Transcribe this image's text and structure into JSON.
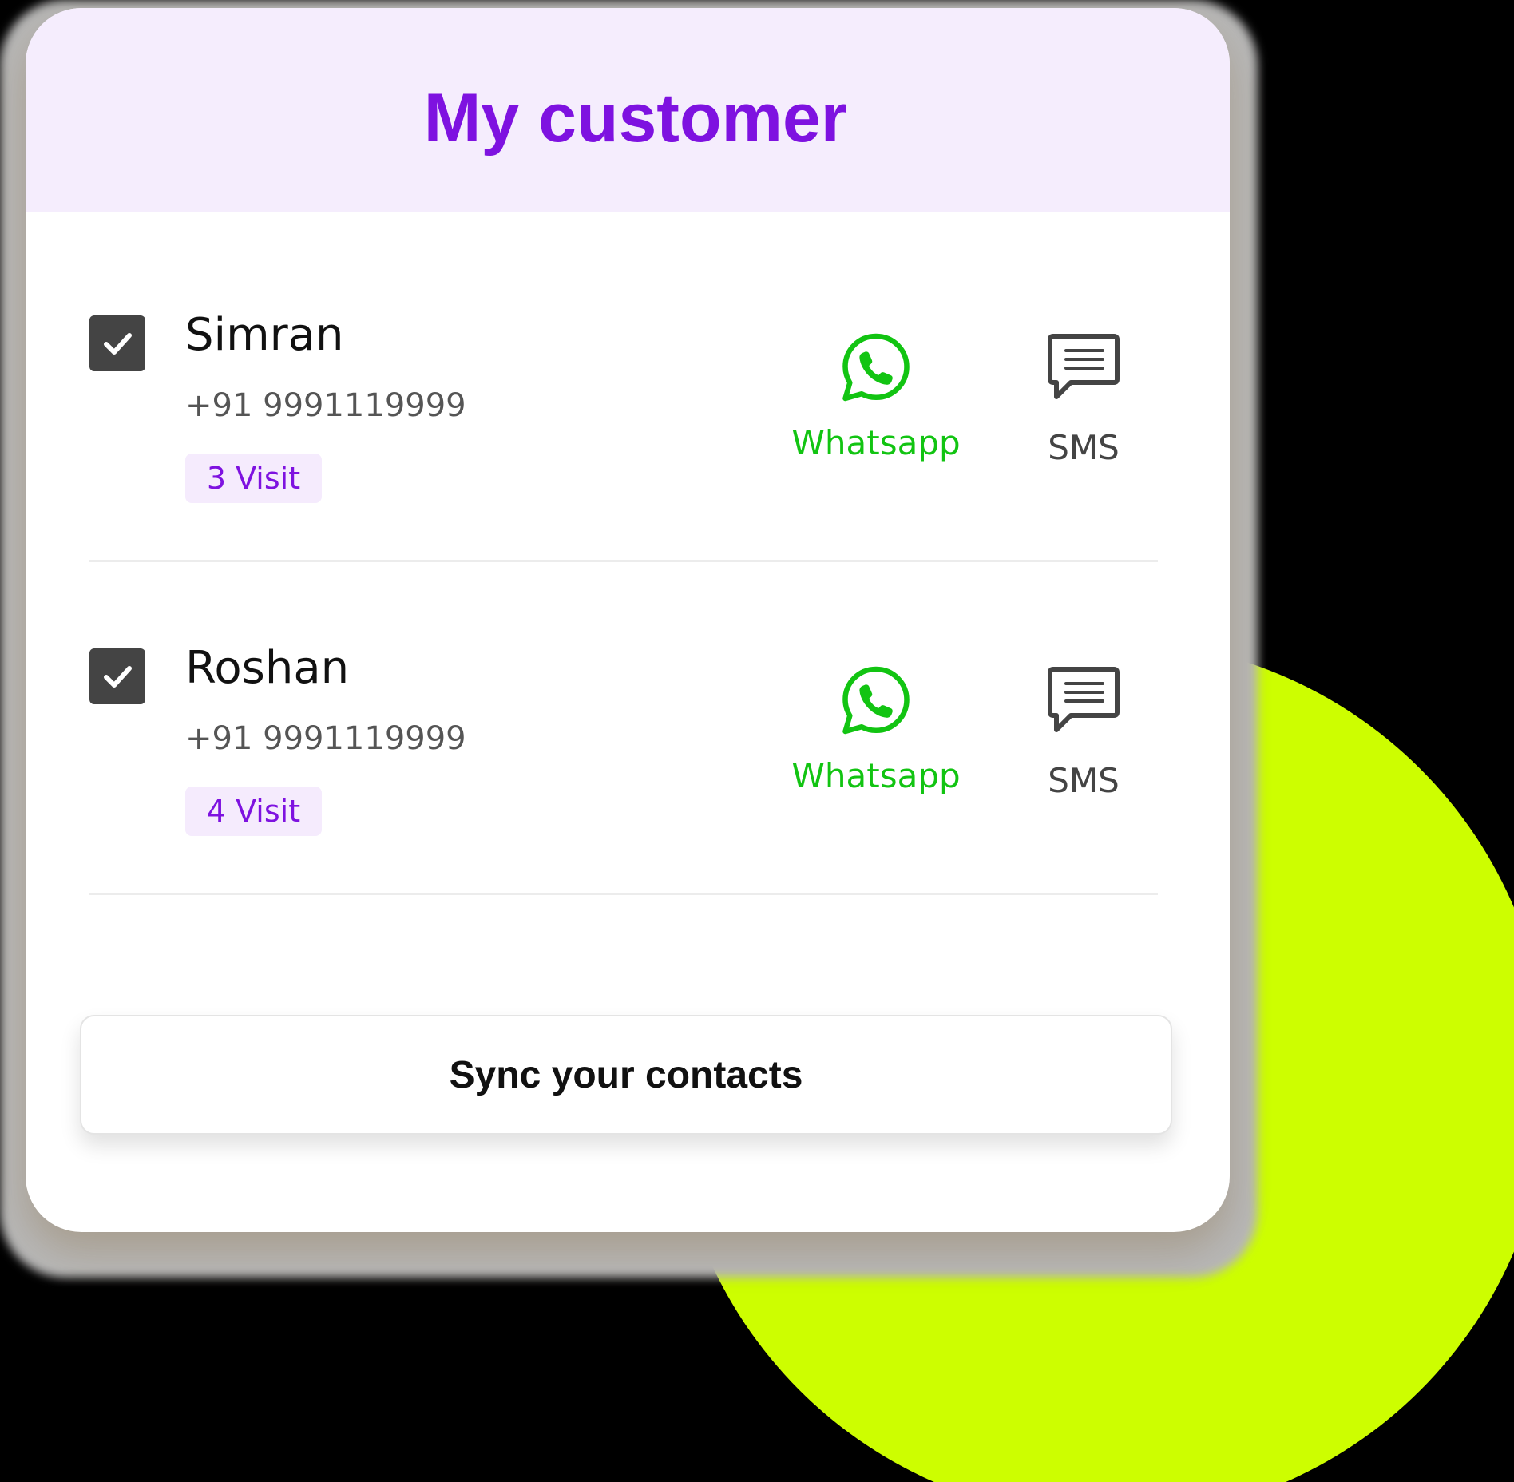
{
  "header": {
    "title": "My customer"
  },
  "customers": [
    {
      "name": "Simran",
      "phone": "+91 9991119999",
      "visits": "3 Visit",
      "selected": true,
      "actions": {
        "whatsapp_label": "Whatsapp",
        "sms_label": "SMS"
      }
    },
    {
      "name": "Roshan",
      "phone": "+91 9991119999",
      "visits": "4 Visit",
      "selected": true,
      "actions": {
        "whatsapp_label": "Whatsapp",
        "sms_label": "SMS"
      }
    }
  ],
  "footer": {
    "sync_label": "Sync your contacts"
  },
  "icons": {
    "checkbox": "check-icon",
    "whatsapp": "whatsapp-icon",
    "sms": "message-icon"
  },
  "colors": {
    "accent": "#7e12e0",
    "header_bg": "#f5edfd",
    "whatsapp": "#12c412",
    "blob": "#cdfe00",
    "checkbox": "#444444"
  }
}
